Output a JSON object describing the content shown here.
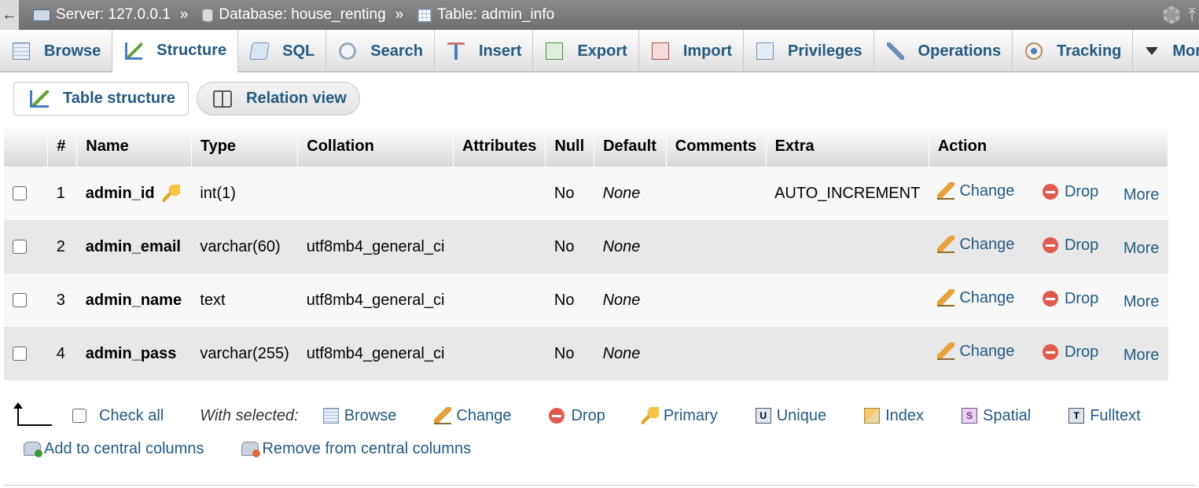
{
  "breadcrumb": {
    "back": "←",
    "server": "Server: 127.0.0.1",
    "sep1": "»",
    "database": "Database: house_renting",
    "sep2": "»",
    "table": "Table: admin_info"
  },
  "tabs": [
    {
      "label": "Browse",
      "icon": "browse-icon",
      "active": false
    },
    {
      "label": "Structure",
      "icon": "structure-icon",
      "active": true
    },
    {
      "label": "SQL",
      "icon": "sql-icon",
      "active": false
    },
    {
      "label": "Search",
      "icon": "search-icon",
      "active": false
    },
    {
      "label": "Insert",
      "icon": "insert-icon",
      "active": false
    },
    {
      "label": "Export",
      "icon": "export-icon",
      "active": false
    },
    {
      "label": "Import",
      "icon": "import-icon",
      "active": false
    },
    {
      "label": "Privileges",
      "icon": "privileges-icon",
      "active": false
    },
    {
      "label": "Operations",
      "icon": "operations-icon",
      "active": false
    },
    {
      "label": "Tracking",
      "icon": "tracking-icon",
      "active": false
    },
    {
      "label": "More",
      "icon": "chevron-down-icon",
      "active": false
    }
  ],
  "subtabs": {
    "table_structure": "Table structure",
    "relation_view": "Relation view"
  },
  "table": {
    "headers": [
      "#",
      "Name",
      "Type",
      "Collation",
      "Attributes",
      "Null",
      "Default",
      "Comments",
      "Extra",
      "Action"
    ],
    "rows": [
      {
        "num": "1",
        "name": "admin_id",
        "primary": true,
        "type": "int(1)",
        "collation": "",
        "attributes": "",
        "null": "No",
        "default": "None",
        "comments": "",
        "extra": "AUTO_INCREMENT"
      },
      {
        "num": "2",
        "name": "admin_email",
        "primary": false,
        "type": "varchar(60)",
        "collation": "utf8mb4_general_ci",
        "attributes": "",
        "null": "No",
        "default": "None",
        "comments": "",
        "extra": ""
      },
      {
        "num": "3",
        "name": "admin_name",
        "primary": false,
        "type": "text",
        "collation": "utf8mb4_general_ci",
        "attributes": "",
        "null": "No",
        "default": "None",
        "comments": "",
        "extra": ""
      },
      {
        "num": "4",
        "name": "admin_pass",
        "primary": false,
        "type": "varchar(255)",
        "collation": "utf8mb4_general_ci",
        "attributes": "",
        "null": "No",
        "default": "None",
        "comments": "",
        "extra": ""
      }
    ],
    "actions": {
      "change": "Change",
      "drop": "Drop",
      "more": "More"
    }
  },
  "bulk": {
    "check_all": "Check all",
    "with_selected": "With selected:",
    "browse": "Browse",
    "change": "Change",
    "drop": "Drop",
    "primary": "Primary",
    "unique": "Unique",
    "index": "Index",
    "spatial": "Spatial",
    "fulltext": "Fulltext",
    "add_central": "Add to central columns",
    "remove_central": "Remove from central columns"
  },
  "colors": {
    "link": "#235a81",
    "breadcrumb_bg": "#7a7a7a",
    "row_odd": "#f8f8f8",
    "row_even": "#e8e8e8"
  }
}
